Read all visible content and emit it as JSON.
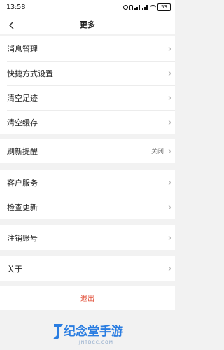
{
  "status_bar": {
    "time": "13:58",
    "battery": "53",
    "icons": [
      "alarm-icon",
      "mute-icon",
      "signal-icon",
      "signal-icon",
      "wifi-icon",
      "battery-icon"
    ]
  },
  "header": {
    "back_icon": "chevron-left-icon",
    "title": "更多"
  },
  "groups": [
    {
      "items": [
        {
          "label": "消息管理",
          "icon": "chevron-right-icon"
        },
        {
          "label": "快捷方式设置",
          "icon": "chevron-right-icon"
        },
        {
          "label": "清空足迹",
          "icon": "chevron-right-icon"
        },
        {
          "label": "清空缓存",
          "icon": "chevron-right-icon"
        }
      ]
    },
    {
      "items": [
        {
          "label": "刷新提醒",
          "value": "关闭",
          "icon": "chevron-right-icon"
        }
      ]
    },
    {
      "items": [
        {
          "label": "客户服务",
          "icon": "chevron-right-icon"
        },
        {
          "label": "检查更新",
          "icon": "chevron-right-icon"
        }
      ]
    },
    {
      "items": [
        {
          "label": "注销账号",
          "icon": "chevron-right-icon"
        }
      ]
    },
    {
      "items": [
        {
          "label": "关于",
          "icon": "chevron-right-icon"
        }
      ]
    }
  ],
  "logout_label": "退出",
  "watermark": {
    "title": "纪念堂手游",
    "subtitle": "JNTDCC.COM"
  },
  "colors": {
    "background": "#f2f2f2",
    "logout": "#e2533d",
    "watermark": "#2a7de1"
  }
}
